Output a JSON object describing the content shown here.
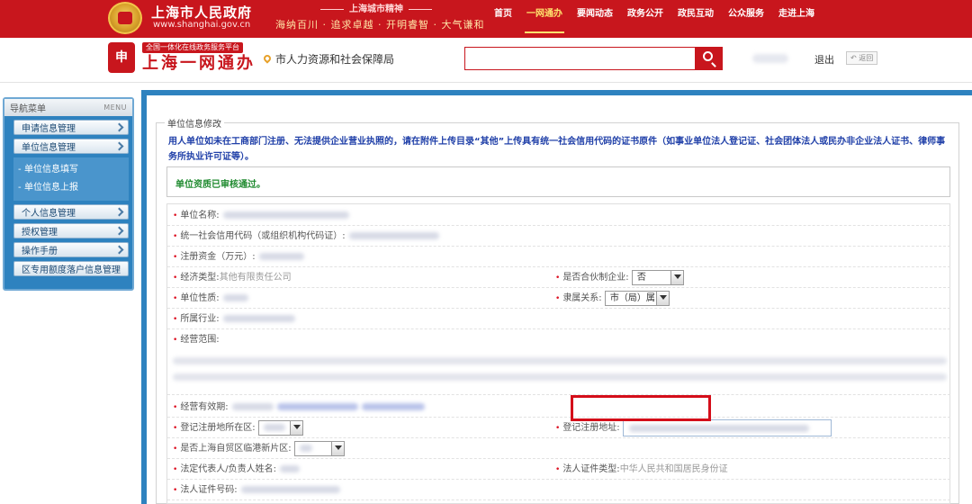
{
  "top": {
    "site_title": "上海市人民政府",
    "site_url": "www.shanghai.gov.cn",
    "spirit_head": "上海城市精神",
    "spirit_text": "海纳百川 · 追求卓越 · 开明睿智 · 大气谦和",
    "nav": [
      "首页",
      "一网通办",
      "要闻动态",
      "政务公开",
      "政民互动",
      "公众服务",
      "走进上海"
    ],
    "nav_active": "一网通办"
  },
  "header2": {
    "badge": "全国一体化在线政务服务平台",
    "title": "上海一网通办",
    "department": "市人力资源和社会保障局",
    "search_value": "",
    "logout": "退出",
    "back": "返回",
    "logo_char": "申"
  },
  "sidebar": {
    "title": "导航菜单",
    "menu_label": "MENU",
    "items": [
      {
        "label": "申请信息管理"
      },
      {
        "label": "单位信息管理"
      }
    ],
    "subitems": [
      "单位信息填写",
      "单位信息上报"
    ],
    "items_after": [
      {
        "label": "个人信息管理"
      },
      {
        "label": "授权管理"
      },
      {
        "label": "操作手册"
      },
      {
        "label": "区专用额度落户信息管理"
      }
    ]
  },
  "form": {
    "legend": "单位信息修改",
    "notice": "用人单位如未在工商部门注册、无法提供企业营业执照的，请在附件上传目录“其他”上传具有统一社会信用代码的证书原件（如事业单位法人登记证、社会团体法人或民办非企业法人证书、律师事务所执业许可证等）。",
    "approved": "单位资质已审核通过。",
    "labels": {
      "unit_name": "单位名称:",
      "credit_code": "统一社会信用代码（或组织机构代码证）:",
      "capital": "注册资金（万元）:",
      "econ_type": "经济类型:",
      "partnership": "是否合伙制企业:",
      "unit_nature": "单位性质:",
      "affiliation": "隶属关系:",
      "industry": "所属行业:",
      "scope": "经营范围:",
      "validity": "经营有效期:",
      "reg_district": "登记注册地所在区:",
      "reg_address": "登记注册地址:",
      "ftz": "是否上海自贸区临港新片区:",
      "legal_rep": "法定代表人/负责人姓名:",
      "cert_type": "法人证件类型:",
      "cert_no": "法人证件号码:"
    },
    "values": {
      "econ_type": "其他有限责任公司",
      "partnership": "否",
      "affiliation": "市（局）属",
      "cert_type": "中华人民共和国居民身份证"
    }
  }
}
